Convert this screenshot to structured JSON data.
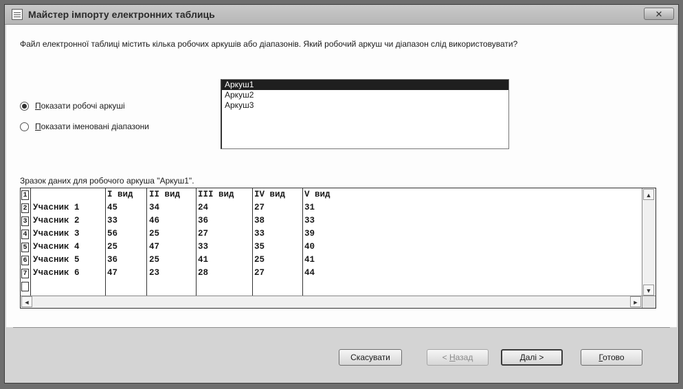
{
  "window": {
    "title": "Майстер імпорту електронних таблиць",
    "close_glyph": "✕",
    "app_icon": "app-window-icon"
  },
  "question": "Файл електронної таблиці містить кілька робочих аркушів або діапазонів. Який робочий аркуш чи діапазон слід використовувати?",
  "options": [
    {
      "label_u": "П",
      "label_rest": "оказати робочі аркуші",
      "checked": true
    },
    {
      "label_u": "П",
      "label_rest": "оказати іменовані діапазони",
      "checked": false
    }
  ],
  "sheets": [
    "Аркуш1",
    "Аркуш2",
    "Аркуш3"
  ],
  "selected_sheet": "Аркуш1",
  "sample_label": "Зразок даних для робочого аркуша \"Аркуш1\".",
  "grid": {
    "row_numbers": [
      "1",
      "2",
      "3",
      "4",
      "5",
      "6",
      "7",
      ""
    ],
    "rows": [
      [
        "",
        "I вид",
        "II вид",
        "III вид",
        "IV вид",
        "V вид"
      ],
      [
        "Учасник 1",
        "45",
        "34",
        "24",
        "27",
        "31"
      ],
      [
        "Учасник 2",
        "33",
        "46",
        "36",
        "38",
        "33"
      ],
      [
        "Учасник 3",
        "56",
        "25",
        "27",
        "33",
        "39"
      ],
      [
        "Учасник 4",
        "25",
        "47",
        "33",
        "35",
        "40"
      ],
      [
        "Учасник 5",
        "36",
        "25",
        "41",
        "25",
        "41"
      ],
      [
        "Учасник 6",
        "47",
        "23",
        "28",
        "27",
        "44"
      ],
      [
        "",
        "",
        "",
        "",
        "",
        ""
      ]
    ]
  },
  "scroll": {
    "up": "▲",
    "down": "▼",
    "left": "◄",
    "right": "►"
  },
  "buttons": {
    "cancel": "Скасувати",
    "back_prefix": "< ",
    "back_u": "Н",
    "back_rest": "азад",
    "next_u": "Д",
    "next_rest": "алі >",
    "finish_u": "Г",
    "finish_rest": "отово"
  }
}
